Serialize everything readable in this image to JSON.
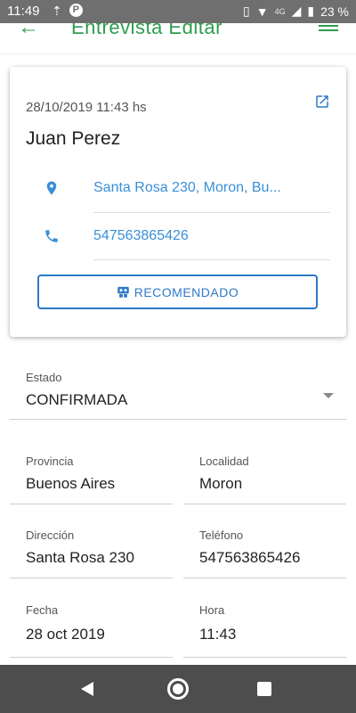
{
  "status_bar": {
    "time": "11:49",
    "network_label": "4G",
    "battery": "23 %",
    "icons": [
      "upload-icon",
      "parking-app-icon",
      "vibrate-icon",
      "wifi-icon",
      "signal-icon",
      "battery-icon"
    ]
  },
  "app_bar": {
    "title": "Entrevista Editar",
    "back_icon": "arrow-left-icon",
    "menu_icon": "hamburger-menu-icon",
    "accent_color": "#2e9c4e"
  },
  "card": {
    "datetime": "28/10/2019 11:43 hs",
    "name": "Juan Perez",
    "address": "Santa Rosa 230, Moron, Bu...",
    "phone": "547563865426",
    "recommend_label": "RECOMENDADO",
    "link_color": "#3a8fd8"
  },
  "form": {
    "estado": {
      "label": "Estado",
      "value": "CONFIRMADA"
    },
    "provincia": {
      "label": "Provincia",
      "value": "Buenos Aires"
    },
    "localidad": {
      "label": "Localidad",
      "value": "Moron"
    },
    "direccion": {
      "label": "Dirección",
      "value": "Santa Rosa 230"
    },
    "telefono": {
      "label": "Teléfono",
      "value": "547563865426"
    },
    "fecha": {
      "label": "Fecha",
      "value": "28 oct 2019"
    },
    "hora": {
      "label": "Hora",
      "value": "11:43"
    }
  }
}
